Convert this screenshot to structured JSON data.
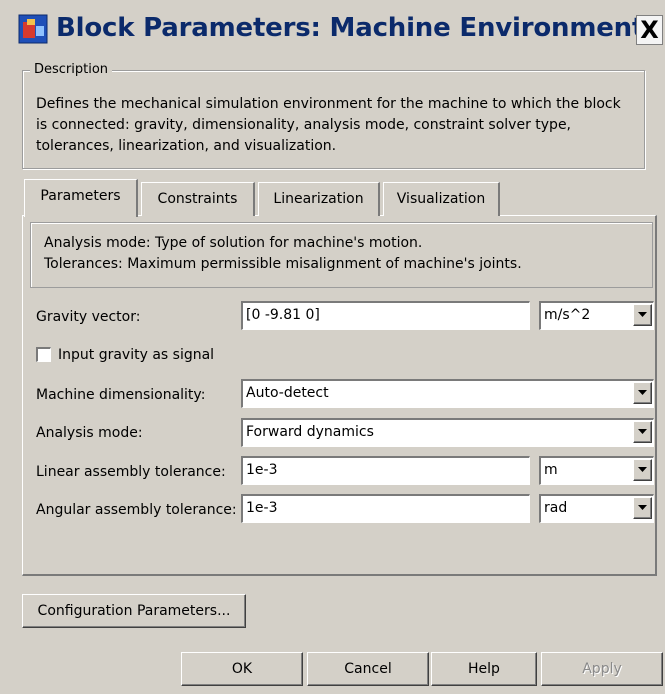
{
  "window": {
    "title": "Block Parameters: Machine Environment",
    "close_glyph": "X"
  },
  "description": {
    "legend": "Description",
    "text": "Defines the mechanical simulation environment for the machine to which the block is connected: gravity, dimensionality, analysis mode, constraint solver type, tolerances, linearization, and visualization."
  },
  "tabs": [
    {
      "label": "Parameters",
      "active": true
    },
    {
      "label": "Constraints",
      "active": false
    },
    {
      "label": "Linearization",
      "active": false
    },
    {
      "label": "Visualization",
      "active": false
    }
  ],
  "info": {
    "line1": "Analysis mode: Type of solution for machine's motion.",
    "line2": "Tolerances: Maximum permissible misalignment of machine's joints."
  },
  "form": {
    "gravity_vector": {
      "label": "Gravity vector:",
      "value": "[0 -9.81 0]",
      "unit": "m/s^2"
    },
    "input_gravity": {
      "label": "Input gravity as signal",
      "checked": false
    },
    "machine_dimensionality": {
      "label": "Machine dimensionality:",
      "value": "Auto-detect"
    },
    "analysis_mode": {
      "label": "Analysis mode:",
      "value": "Forward dynamics"
    },
    "linear_tolerance": {
      "label": "Linear assembly tolerance:",
      "value": "1e-3",
      "unit": "m"
    },
    "angular_tolerance": {
      "label": "Angular assembly tolerance:",
      "value": "1e-3",
      "unit": "rad"
    }
  },
  "buttons": {
    "config": "Configuration Parameters...",
    "ok": "OK",
    "cancel": "Cancel",
    "help": "Help",
    "apply": "Apply"
  },
  "colors": {
    "background": "#d4d0c8",
    "title_text": "#0b2a6b",
    "disabled_text": "#8a8a8a"
  },
  "icons": [
    "simulink-block-icon",
    "close-icon",
    "chevron-down-icon",
    "checkbox-icon"
  ]
}
